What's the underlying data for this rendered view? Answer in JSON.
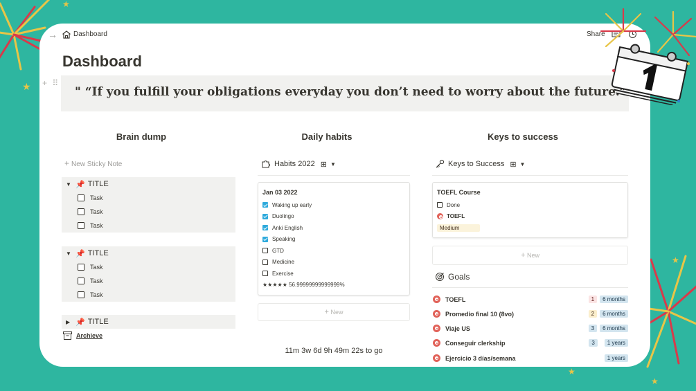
{
  "breadcrumb": {
    "page": "Dashboard"
  },
  "topbar": {
    "share_label": "Share"
  },
  "page_title": "Dashboard",
  "quote": "\" “If you fulfill your obligations everyday you don’t need to worry about the future.”\"",
  "columns": {
    "brain_dump": "Brain dump",
    "daily_habits": "Daily habits",
    "keys_to_success": "Keys to success"
  },
  "brain_dump": {
    "new_sticky_label": "New Sticky Note",
    "toggles": [
      {
        "title": "TITLE",
        "tasks": [
          "Task",
          "Task",
          "Task"
        ]
      },
      {
        "title": "TITLE",
        "tasks": [
          "Task",
          "Task",
          "Task"
        ]
      },
      {
        "title": "TITLE"
      }
    ],
    "archive_label": "Archieve"
  },
  "habits": {
    "db_title": "Habits 2022",
    "card": {
      "date": "Jan 03 2022",
      "items": [
        {
          "label": "Waking up early",
          "checked": true
        },
        {
          "label": "Duolingo",
          "checked": true
        },
        {
          "label": "Anki English",
          "checked": true
        },
        {
          "label": "Speaking",
          "checked": true
        },
        {
          "label": "GTD",
          "checked": false
        },
        {
          "label": "Medicine",
          "checked": false
        },
        {
          "label": "Exercise",
          "checked": false
        }
      ],
      "rating": "★★★★★ 56.99999999999999%"
    },
    "new_label": "New",
    "countdown": "11m 3w 6d 9h 49m 22s to go"
  },
  "keys": {
    "db_title": "Keys to Success",
    "card": {
      "title": "TOEFL Course",
      "done_label": "Done",
      "goal_label": "TOEFL",
      "level": "Medium"
    },
    "new_label": "New"
  },
  "goals": {
    "title": "Goals",
    "rows": [
      {
        "name": "TOEFL",
        "num": "1",
        "num_color": "red",
        "time": "6 months"
      },
      {
        "name": "Promedio final 10 (8vo)",
        "num": "2",
        "num_color": "yellow",
        "time": "6 months"
      },
      {
        "name": "Viaje US",
        "num": "3",
        "num_color": "blue",
        "time": "6 months"
      },
      {
        "name": "Conseguir clerkship",
        "num": "3",
        "num_color": "blue",
        "time": "1 years"
      },
      {
        "name": "Ejercicio 3 días/semana",
        "num": "",
        "num_color": "",
        "time": "1 years"
      }
    ]
  },
  "colors": {
    "background": "#2eb6a0",
    "checkbox_checked": "#2eaadc",
    "target_red": "#e16259"
  }
}
